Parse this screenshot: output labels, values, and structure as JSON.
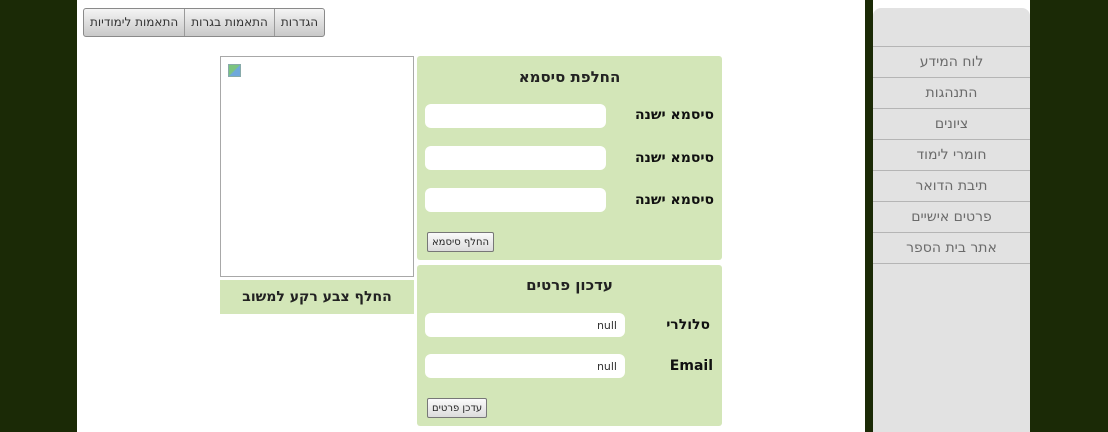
{
  "top_tabs": [
    "הגדרות",
    "התאמות בגרות",
    "התאמות לימודיות"
  ],
  "sidebar": {
    "items": [
      {
        "label": "לוח המידע"
      },
      {
        "label": "התנהגות"
      },
      {
        "label": "ציונים"
      },
      {
        "label": "חומרי לימוד"
      },
      {
        "label": "תיבת הדואר"
      },
      {
        "label": "פרטים אישיים"
      },
      {
        "label": "אתר בית הספר"
      }
    ]
  },
  "profile": {
    "change_bg_label": "החלף צבע רקע למשוב"
  },
  "password_panel": {
    "title": "החלפת סיסמא",
    "fields": [
      {
        "label": "סיסמא ישנה",
        "value": ""
      },
      {
        "label": "סיסמא ישנה",
        "value": ""
      },
      {
        "label": "סיסמא ישנה",
        "value": ""
      }
    ],
    "button_label": "החלף סיסמא"
  },
  "details_panel": {
    "title": "עדכון פרטים",
    "fields": [
      {
        "label": "סלולרי",
        "value": "null"
      },
      {
        "label": "Email",
        "value": "null"
      }
    ],
    "button_label": "עדכן פרטים"
  }
}
